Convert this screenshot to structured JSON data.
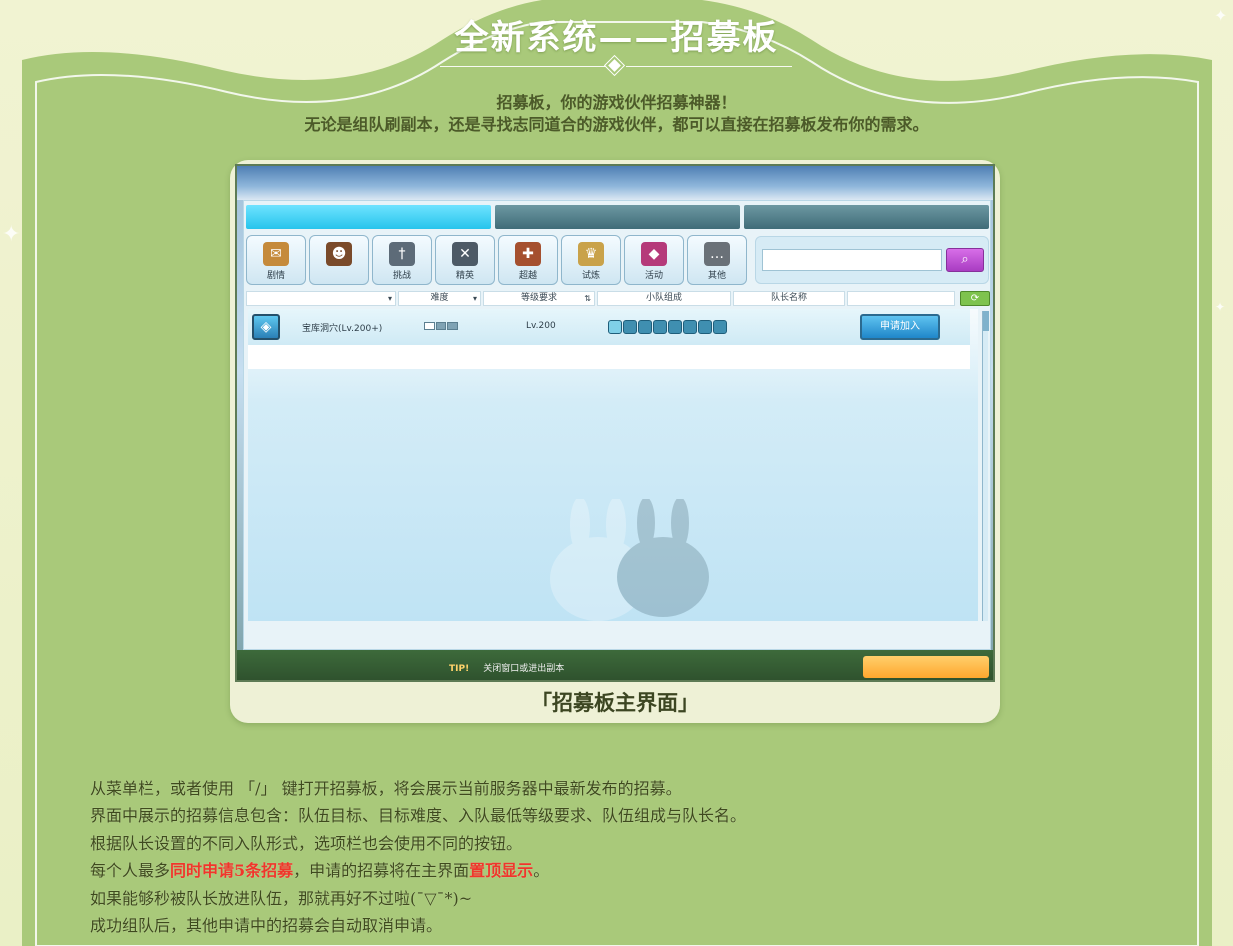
{
  "header": {
    "title": "全新系统——招募板",
    "intro_line1": "招募板，你的游戏伙伴招募神器！",
    "intro_line2": "无论是组队刷副本，还是寻找志同道合的游戏伙伴，都可以直接在招募板发布你的需求。"
  },
  "screenshot": {
    "categories": [
      {
        "label": "剧情",
        "icon": "scroll-icon",
        "color": "#c58a3b"
      },
      {
        "label": "",
        "icon": "character-icon",
        "color": "#7a4a2a"
      },
      {
        "label": "挑战",
        "icon": "sword-icon",
        "color": "#5d6b78"
      },
      {
        "label": "精英",
        "icon": "crossed-swords-icon",
        "color": "#4d5a66"
      },
      {
        "label": "超越",
        "icon": "warrior-icon",
        "color": "#a5502f"
      },
      {
        "label": "试炼",
        "icon": "crown-icon",
        "color": "#c9a24a"
      },
      {
        "label": "活动",
        "icon": "gem-icon",
        "color": "#b53a7a"
      },
      {
        "label": "其他",
        "icon": "chat-bubble-icon",
        "color": "#6a7178"
      }
    ],
    "search": {
      "placeholder": "",
      "button_icon": "search-icon"
    },
    "columns": {
      "difficulty": "难度",
      "level_req": "等级要求",
      "party": "小队组成",
      "leader": "队长名称"
    },
    "row": {
      "dungeon_name": "宝库洞穴(Lv.200+)",
      "difficulty_filled": 1,
      "difficulty_total": 3,
      "level": "Lv.200",
      "party_slots": 8,
      "apply_label": "申请加入"
    },
    "footer": {
      "tip_label": "TIP!",
      "tip_text": "关闭窗口或进出副本"
    },
    "caption": "「招募板主界面」"
  },
  "body": {
    "line1": "从菜单栏，或者使用 「/」 键打开招募板，将会展示当前服务器中最新发布的招募。",
    "line2": "界面中展示的招募信息包含：队伍目标、目标难度、入队最低等级要求、队伍组成与队长名。",
    "line3": "根据队长设置的不同入队形式，选项栏也会使用不同的按钮。",
    "line4_a": "每个人最多",
    "line4_b": "同时申请5条招募",
    "line4_c": "，申请的招募将在主界面",
    "line4_d": "置顶显示",
    "line4_e": "。",
    "line5": "如果能够秒被队长放进队伍，那就再好不过啦(¯▽¯*)~",
    "line6": "成功组队后，其他申请中的招募会自动取消申请。"
  },
  "colors": {
    "page_bg": "#a9c97a",
    "highlight": "#f0362b",
    "text": "#3f4a1e",
    "apply_button": "#1f86c9",
    "search_button": "#a93cc2"
  }
}
